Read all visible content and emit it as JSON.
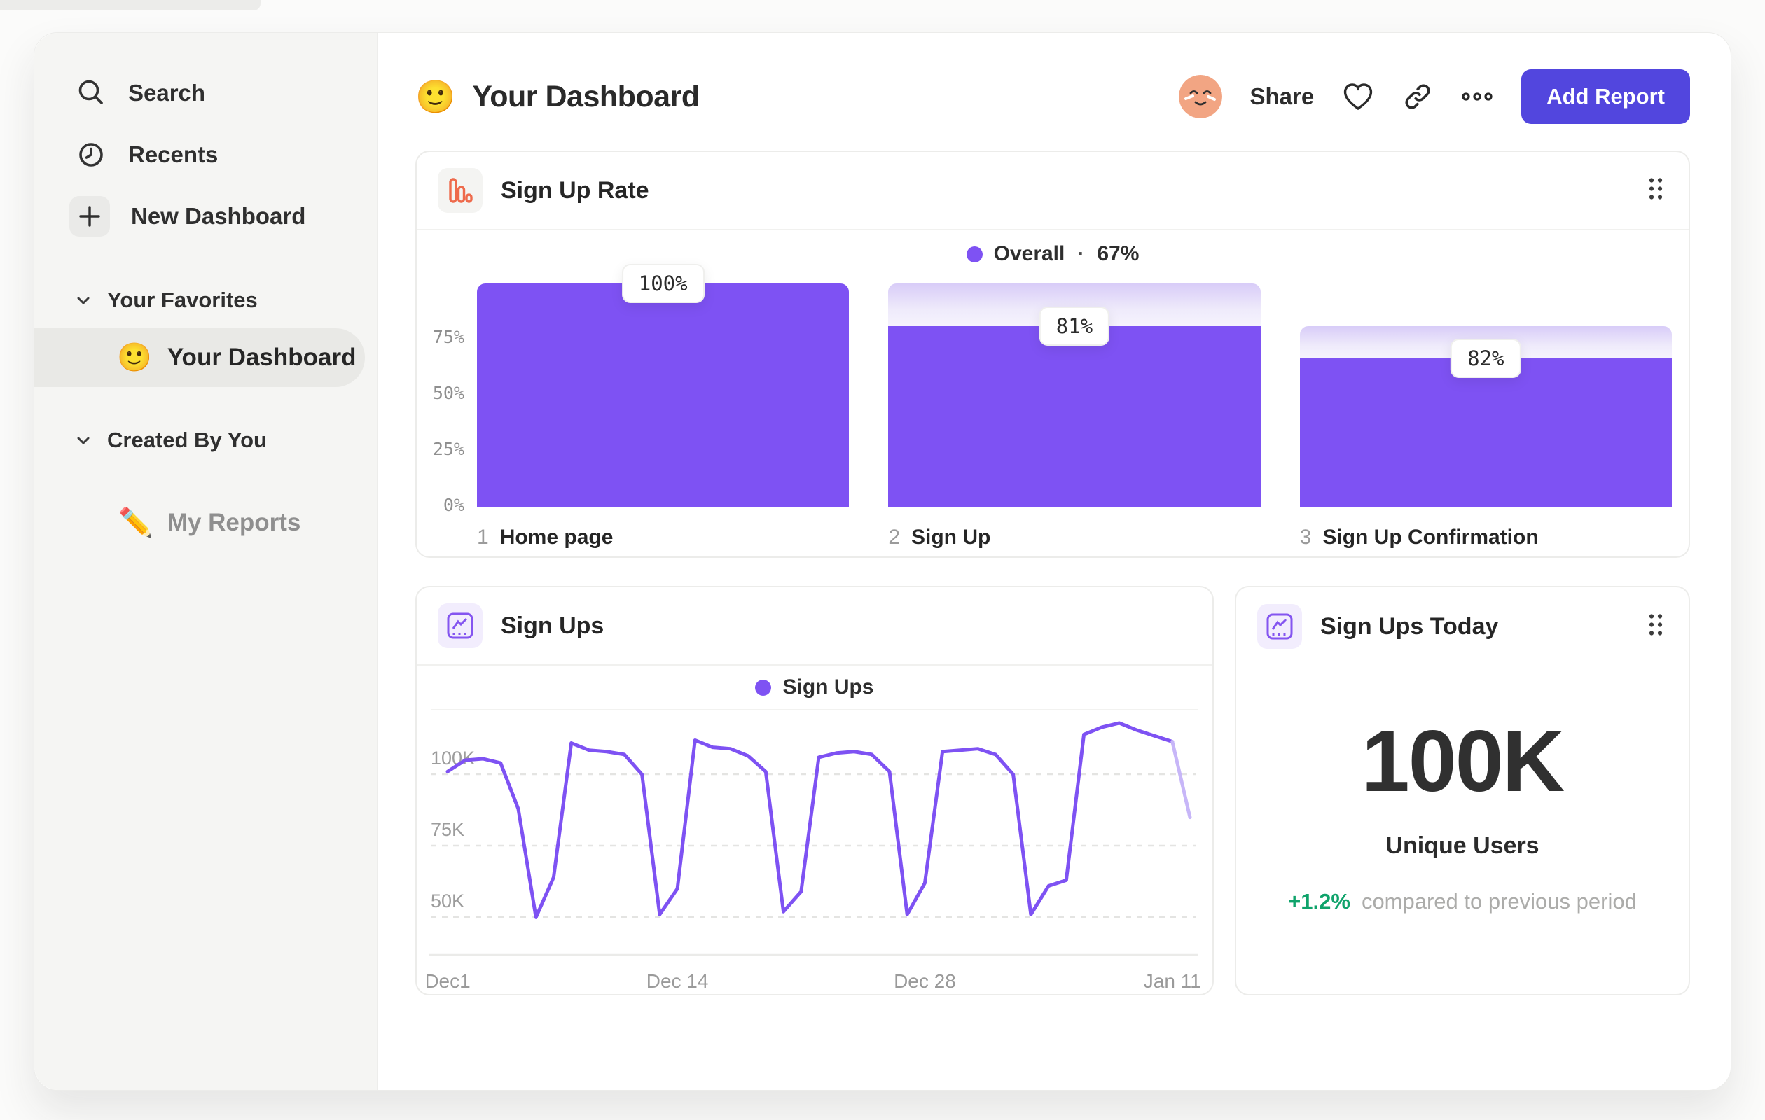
{
  "colors": {
    "accent": "#7E52F3",
    "accent_faded": "#C7B6F8",
    "indigo": "#5246DE",
    "orange": "#EE6A4C",
    "green": "#0FA36B"
  },
  "sidebar": {
    "items": [
      {
        "label": "Search",
        "icon": "search-icon"
      },
      {
        "label": "Recents",
        "icon": "clock-icon"
      },
      {
        "label": "New Dashboard",
        "icon": "plus-icon"
      }
    ],
    "sections": [
      {
        "label": "Your Favorites",
        "item": {
          "emoji": "🙂",
          "label": "Your Dashboard",
          "selected": true
        }
      },
      {
        "label": "Created By You",
        "item": {
          "emoji": "✏️",
          "label": "My Reports",
          "selected": false
        }
      }
    ]
  },
  "header": {
    "emoji": "🙂",
    "title": "Your Dashboard",
    "share_label": "Share",
    "add_report_label": "Add Report",
    "icons": [
      "avatar",
      "heart-icon",
      "link-icon",
      "ellipsis-icon"
    ]
  },
  "cards": {
    "funnel": {
      "title": "Sign Up Rate",
      "icon": "bar-chart-icon",
      "legend_name": "Overall",
      "legend_sep": "·",
      "legend_value": "67%"
    },
    "line": {
      "title": "Sign Ups",
      "icon": "line-chart-icon",
      "legend_name": "Sign Ups"
    },
    "stat": {
      "title": "Sign Ups Today",
      "icon": "line-chart-icon",
      "value": "100K",
      "label": "Unique Users",
      "delta": "+1.2%",
      "delta_note": "compared to previous period"
    }
  },
  "chart_data": [
    {
      "type": "bar",
      "title": "Sign Up Rate",
      "legend": [
        {
          "name": "Overall",
          "value": "67%"
        }
      ],
      "categories": [
        "Home page",
        "Sign Up",
        "Sign Up Confirmation"
      ],
      "step_numbers": [
        "1",
        "2",
        "3"
      ],
      "step_labels": [
        "100%",
        "81%",
        "82%"
      ],
      "solid_pct": [
        100,
        81,
        66.5
      ],
      "prev_pct": [
        100,
        100,
        81
      ],
      "yticks": [
        {
          "label": "75%",
          "v": 75
        },
        {
          "label": "50%",
          "v": 50
        },
        {
          "label": "25%",
          "v": 25
        },
        {
          "label": "0%",
          "v": 0
        }
      ],
      "ylim": [
        0,
        100
      ],
      "grid": false,
      "legend_position": "top-center"
    },
    {
      "type": "line",
      "title": "Sign Ups",
      "legend": [
        "Sign Ups"
      ],
      "unit": "K",
      "values_k": [
        96,
        100,
        100.5,
        99,
        83,
        45,
        59,
        106,
        103.5,
        103,
        102,
        95,
        46,
        55,
        107,
        104.5,
        104,
        101.5,
        96,
        47,
        54,
        101,
        102.5,
        103,
        102,
        96,
        46,
        57,
        103,
        103.5,
        104,
        102,
        95,
        46,
        56,
        58,
        109,
        111.5,
        113,
        110.5,
        108.5,
        106.5,
        80
      ],
      "x_ticks": [
        {
          "label": "Dec1",
          "index": 0
        },
        {
          "label": "Dec 14",
          "index": 13
        },
        {
          "label": "Dec 28",
          "index": 27
        },
        {
          "label": "Jan 11",
          "index": 41
        }
      ],
      "yticks": [
        {
          "label": "100K",
          "v": 100
        },
        {
          "label": "75K",
          "v": 75
        },
        {
          "label": "50K",
          "v": 50
        }
      ],
      "grid": "dashed-horizontal",
      "faded_last_segments": 1,
      "legend_position": "top-center"
    }
  ]
}
